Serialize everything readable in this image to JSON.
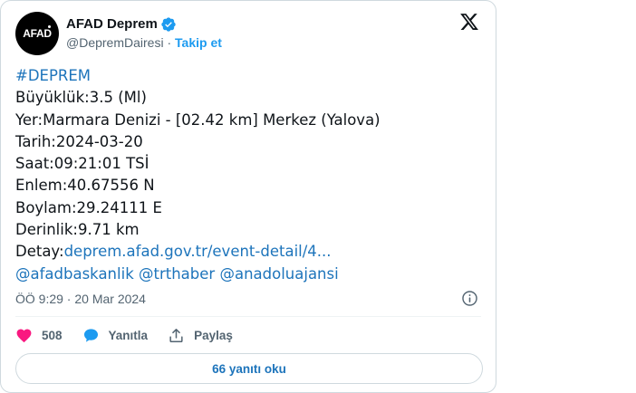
{
  "account": {
    "avatar_text": "AFAD",
    "name": "AFAD Deprem",
    "handle": "@DepremDairesi",
    "separator": "·",
    "follow_label": "Takip et"
  },
  "tweet": {
    "hashtag": "#DEPREM",
    "lines": [
      "Büyüklük:3.5 (Ml)",
      "Yer:Marmara Denizi - [02.42 km] Merkez (Yalova)",
      "Tarih:2024-03-20",
      "Saat:09:21:01 TSİ",
      "Enlem:40.67556 N",
      "Boylam:29.24111 E",
      "Derinlik:9.71 km"
    ],
    "detail_label": "Detay:",
    "detail_link": "deprem.afad.gov.tr/event-detail/4...",
    "mentions": [
      "@afadbaskanlik",
      "@trthaber",
      "@anadoluajansi"
    ]
  },
  "meta": {
    "timestamp": "ÖÖ 9:29 · 20 Mar 2024"
  },
  "actions": {
    "like_count": "508",
    "reply_label": "Yanıtla",
    "share_label": "Paylaş"
  },
  "replies_button": "66 yanıtı oku",
  "colors": {
    "link": "#1d74bb",
    "like": "#f91880",
    "reply_icon": "#1d9bf0",
    "verified": "#1d9bf0"
  },
  "icons": [
    "verified-badge-icon",
    "x-logo-icon",
    "info-icon",
    "heart-icon",
    "reply-bubble-icon",
    "share-icon"
  ]
}
